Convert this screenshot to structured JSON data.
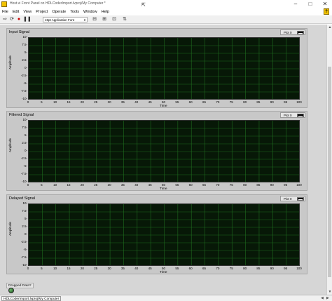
{
  "window": {
    "title": "Host.vi Front Panel on HDLCoderImport.lvproj/My Computer *"
  },
  "menu": [
    "File",
    "Edit",
    "View",
    "Project",
    "Operate",
    "Tools",
    "Window",
    "Help"
  ],
  "toolbar": {
    "font": "15pt Application Font"
  },
  "graphs": [
    {
      "label": "Input Signal",
      "legend": "Plot 0",
      "ylabel": "Amplitude",
      "xlabel": "Time",
      "yticks": [
        "10-",
        "7.5-",
        "5-",
        "2.5-",
        "0-",
        "-2.5-",
        "-5-",
        "-7.5-",
        "-10-"
      ],
      "xticks": [
        "0",
        "5",
        "10",
        "15",
        "20",
        "25",
        "30",
        "35",
        "40",
        "45",
        "50",
        "55",
        "60",
        "65",
        "70",
        "75",
        "80",
        "85",
        "90",
        "95",
        "100"
      ]
    },
    {
      "label": "Filtered Signal",
      "legend": "Plot 0",
      "ylabel": "Amplitude",
      "xlabel": "Time",
      "yticks": [
        "10-",
        "7.5-",
        "5-",
        "2.5-",
        "0-",
        "-2.5-",
        "-5-",
        "-7.5-",
        "-10-"
      ],
      "xticks": [
        "0",
        "5",
        "10",
        "15",
        "20",
        "25",
        "30",
        "35",
        "40",
        "45",
        "50",
        "55",
        "60",
        "65",
        "70",
        "75",
        "80",
        "85",
        "90",
        "95",
        "100"
      ]
    },
    {
      "label": "Delayed Signal",
      "legend": "Plot 0",
      "ylabel": "Amplitude",
      "xlabel": "Time",
      "yticks": [
        "10-",
        "7.5-",
        "5-",
        "2.5-",
        "0-",
        "-2.5-",
        "-5-",
        "-7.5-",
        "-10-"
      ],
      "xticks": [
        "0",
        "5",
        "10",
        "15",
        "20",
        "25",
        "30",
        "35",
        "40",
        "45",
        "50",
        "55",
        "60",
        "65",
        "70",
        "75",
        "80",
        "85",
        "90",
        "95",
        "100"
      ]
    }
  ],
  "indicator": {
    "label": "Dropped Data?"
  },
  "status": {
    "project": "HDLCoderImport.lvproj/My Computer"
  },
  "colors": {
    "plot_background": "#071807",
    "grid": "#1f6b1f",
    "panel": "#d6d6d6",
    "led_off": "#2f6b2f"
  }
}
